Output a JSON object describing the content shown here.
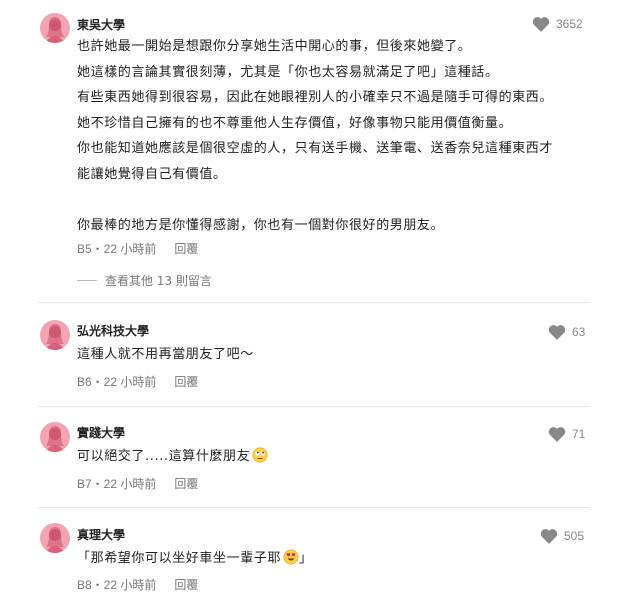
{
  "comments": [
    {
      "school": "東吳大學",
      "likes": "3652",
      "lines": [
        "也許她最一開始是想跟你分享她生活中開心的事，但後來她變了。",
        "她這樣的言論其實很刻薄，尤其是「你也太容易就滿足了吧」這種話。",
        "有些東西她得到很容易，因此在她眼裡別人的小確幸只不過是隨手可得的東西。",
        "她不珍惜自己擁有的也不尊重他人生存價值，好像事物只能用價值衡量。",
        "你也能知道她應該是個很空虛的人，只有送手機、送筆電、送香奈兒這種東西才",
        "能讓她覺得自己有價值。",
        "",
        "你最棒的地方是你懂得感謝，你也有一個對你很好的男朋友。"
      ],
      "floor": "B5・22 小時前",
      "reply": "回覆",
      "more_replies": "查看其他 13 則留言"
    },
    {
      "school": "弘光科技大學",
      "likes": "63",
      "text": "這種人就不用再當朋友了吧～",
      "floor": "B6・22 小時前",
      "reply": "回覆"
    },
    {
      "school": "實踐大學",
      "likes": "71",
      "text": "可以絕交了.....這算什麼朋友",
      "floor": "B7・22 小時前",
      "reply": "回覆"
    },
    {
      "school": "真理大學",
      "likes": "505",
      "text_before": "「那希望你可以坐好車坐一輩子耶",
      "text_after": "」",
      "floor": "B8・22 小時前",
      "reply": "回覆"
    }
  ],
  "icons": {
    "avatar": "female-avatar-icon",
    "heart": "heart-icon"
  },
  "colors": {
    "avatar_bg": "#f4a3b3",
    "heart": "#888888"
  }
}
